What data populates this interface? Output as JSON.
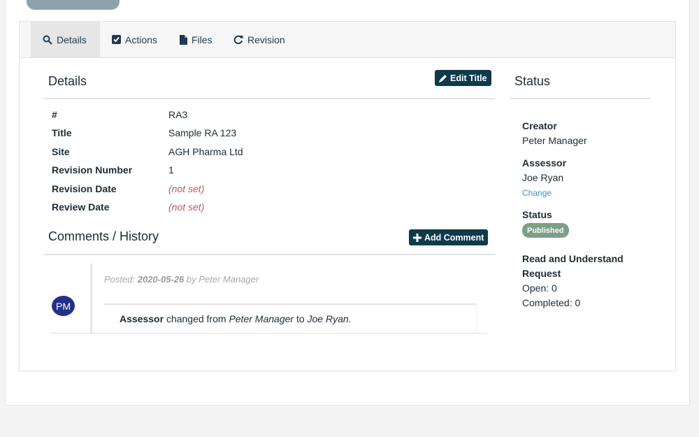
{
  "tabs": {
    "details": "Details",
    "actions": "Actions",
    "files": "Files",
    "revision": "Revision"
  },
  "details": {
    "title": "Details",
    "edit_button": "Edit Title",
    "fields": [
      {
        "label": "#",
        "value": "RA3"
      },
      {
        "label": "Title",
        "value": "Sample RA 123"
      },
      {
        "label": "Site",
        "value": "AGH Pharma Ltd"
      },
      {
        "label": "Revision Number",
        "value": "1"
      },
      {
        "label": "Revision Date",
        "value": "(not set)"
      },
      {
        "label": "Review Date",
        "value": "(not set)"
      }
    ]
  },
  "comments": {
    "title": "Comments / History",
    "add_button": "Add Comment",
    "entry": {
      "avatar": "PM",
      "posted_prefix": "Posted:",
      "date": "2020-05-26",
      "by": "by",
      "author": "Peter Manager",
      "field": "Assessor",
      "changed_from": "changed from",
      "from_value": "Peter Manager",
      "to": "to",
      "to_value": "Joe Ryan."
    }
  },
  "status": {
    "title": "Status",
    "creator_label": "Creator",
    "creator": "Peter Manager",
    "assessor_label": "Assessor",
    "assessor": "Joe Ryan",
    "change_link": "Change",
    "status_label": "Status",
    "status_badge": "Published",
    "rau_label_1": "Read and Understand",
    "rau_label_2": "Request",
    "open": "Open: 0",
    "completed": "Completed: 0"
  },
  "colors": {
    "primary": "#0e3a4b",
    "avatar": "#23308c",
    "badge": "#7c9f86",
    "link": "#3a93b5",
    "not_set": "#b85a5a"
  }
}
